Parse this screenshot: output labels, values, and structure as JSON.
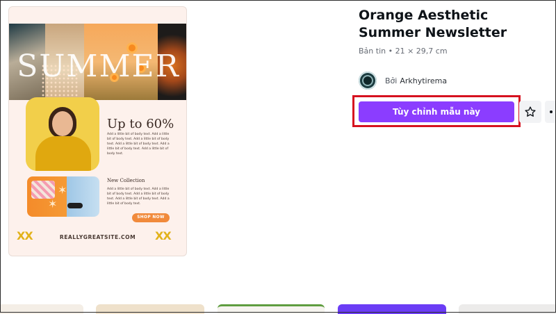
{
  "preview": {
    "headline": "SUMMER",
    "promo_title": "Up to 60%",
    "promo_text": "Add a little bit of body text. Add a little bit of body text. Add a little bit of body text. Add a little bit of body text. Add a little bit of body text. Add a little bit of body text.",
    "collection_title": "New Collection",
    "collection_text": "Add a little bit of body text. Add a little bit of body text. Add a little bit of body text. Add a little bit of body text. Add a little bit of body text.",
    "shop_button": "SHOP NOW",
    "decor_mark": "XX",
    "website": "REALLYGREATSITE.COM"
  },
  "details": {
    "title": "Orange Aesthetic Summer Newsletter",
    "subtitle": "Bản tin • 21 × 29,7 cm",
    "by_label": "Bởi",
    "author_name": "Arkhytirema",
    "cta_label": "Tùy chỉnh mẫu này"
  },
  "icons": {
    "favorite": "star-outline-icon",
    "more": "more-icon"
  },
  "colors": {
    "cta": "#8b3dff",
    "highlight": "#d6111f",
    "accent_orange": "#f18a3b",
    "accent_yellow": "#e2b21b"
  }
}
